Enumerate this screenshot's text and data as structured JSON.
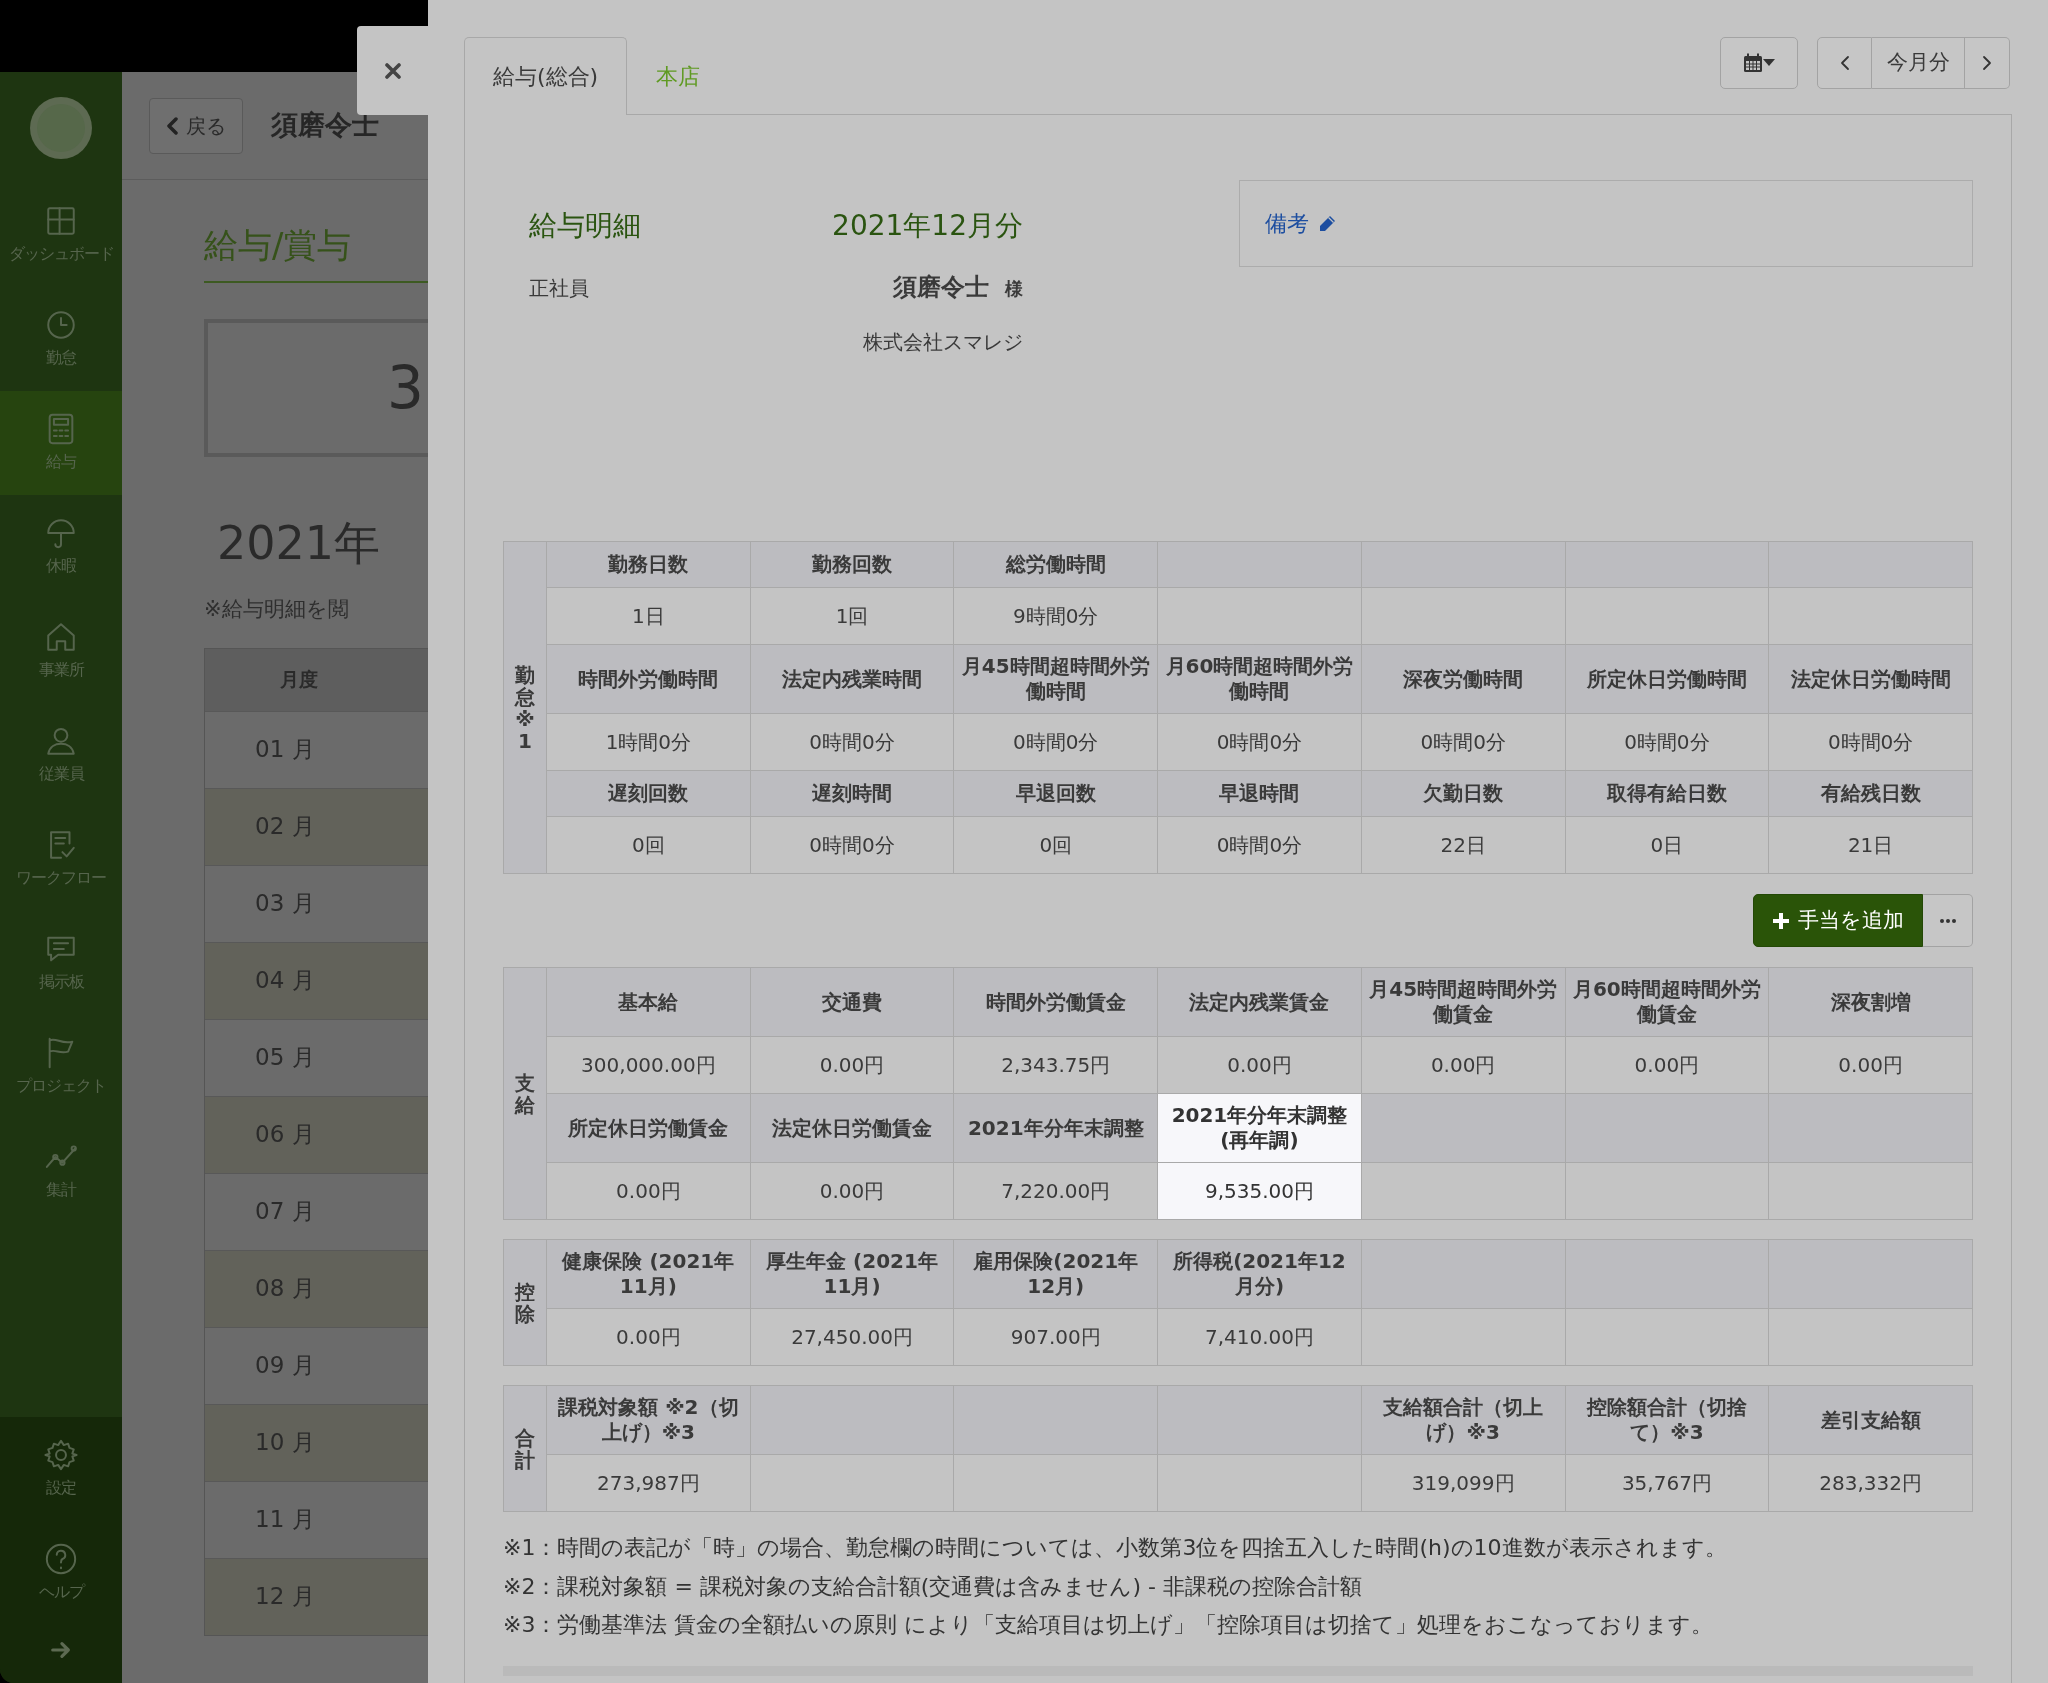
{
  "sidebar": {
    "items": [
      {
        "label": "ダッシュボード",
        "selected": false
      },
      {
        "label": "勤怠",
        "selected": false
      },
      {
        "label": "給与",
        "selected": true
      },
      {
        "label": "休暇",
        "selected": false
      },
      {
        "label": "事業所",
        "selected": false
      },
      {
        "label": "従業員",
        "selected": false
      },
      {
        "label": "ワークフロー",
        "selected": false
      },
      {
        "label": "掲示板",
        "selected": false
      },
      {
        "label": "プロジェクト",
        "selected": false
      },
      {
        "label": "集計",
        "selected": false
      }
    ],
    "footer_items": [
      {
        "label": "設定"
      },
      {
        "label": "ヘルプ"
      }
    ]
  },
  "background_page": {
    "back_button": "戻る",
    "employee_name": "須磨令士",
    "heading": "給与/賞与",
    "summary_value": "3",
    "year": "2021年",
    "note": "※給与明細を閲",
    "month_header": "月度",
    "months": [
      "01 月",
      "02 月",
      "03 月",
      "04 月",
      "05 月",
      "06 月",
      "07 月",
      "08 月",
      "09 月",
      "10 月",
      "11 月",
      "12 月"
    ]
  },
  "modal": {
    "tabs": [
      {
        "label": "給与(総合)",
        "selected": true
      },
      {
        "label": "本店",
        "selected": false
      }
    ],
    "period_button": "今月分",
    "payslip": {
      "title": "給与明細",
      "period": "2021年12月分",
      "employment_type": "正社員",
      "employee_name": "須磨令士",
      "honorific": "様",
      "company": "株式会社スマレジ",
      "remarks_label": "備考"
    },
    "add_button": "手当を追加",
    "sections": [
      {
        "label": "勤怠※1",
        "groups": [
          {
            "cells": [
              {
                "header": "勤務日数",
                "value": "1日",
                "highlighted": false
              },
              {
                "header": "勤務回数",
                "value": "1回",
                "highlighted": false
              },
              {
                "header": "総労働時間",
                "value": "9時間0分",
                "highlighted": false
              },
              {
                "highlighted": false
              },
              {
                "highlighted": false
              },
              {
                "highlighted": false
              },
              {
                "highlighted": false
              }
            ]
          },
          {
            "cells": [
              {
                "header": "時間外労働時間",
                "value": "1時間0分",
                "highlighted": false
              },
              {
                "header": "法定内残業時間",
                "value": "0時間0分",
                "highlighted": false
              },
              {
                "header": "月45時間超時間外労働時間",
                "value": "0時間0分",
                "highlighted": false
              },
              {
                "header": "月60時間超時間外労働時間",
                "value": "0時間0分",
                "highlighted": false
              },
              {
                "header": "深夜労働時間",
                "value": "0時間0分",
                "highlighted": false
              },
              {
                "header": "所定休日労働時間",
                "value": "0時間0分",
                "highlighted": false
              },
              {
                "header": "法定休日労働時間",
                "value": "0時間0分",
                "highlighted": false
              }
            ]
          },
          {
            "cells": [
              {
                "header": "遅刻回数",
                "value": "0回",
                "highlighted": false
              },
              {
                "header": "遅刻時間",
                "value": "0時間0分",
                "highlighted": false
              },
              {
                "header": "早退回数",
                "value": "0回",
                "highlighted": false
              },
              {
                "header": "早退時間",
                "value": "0時間0分",
                "highlighted": false
              },
              {
                "header": "欠勤日数",
                "value": "22日",
                "highlighted": false
              },
              {
                "header": "取得有給日数",
                "value": "0日",
                "highlighted": false
              },
              {
                "header": "有給残日数",
                "value": "21日",
                "highlighted": false
              }
            ]
          }
        ]
      },
      {
        "label": "支給",
        "groups": [
          {
            "cells": [
              {
                "header": "基本給",
                "value": "300,000.00円",
                "highlighted": false
              },
              {
                "header": "交通費",
                "value": "0.00円",
                "highlighted": false
              },
              {
                "header": "時間外労働賃金",
                "value": "2,343.75円",
                "highlighted": false
              },
              {
                "header": "法定内残業賃金",
                "value": "0.00円",
                "highlighted": false
              },
              {
                "header": "月45時間超時間外労働賃金",
                "value": "0.00円",
                "highlighted": false
              },
              {
                "header": "月60時間超時間外労働賃金",
                "value": "0.00円",
                "highlighted": false
              },
              {
                "header": "深夜割増",
                "value": "0.00円",
                "highlighted": false
              }
            ]
          },
          {
            "cells": [
              {
                "header": "所定休日労働賃金",
                "value": "0.00円",
                "highlighted": false
              },
              {
                "header": "法定休日労働賃金",
                "value": "0.00円",
                "highlighted": false
              },
              {
                "header": "2021年分年末調整",
                "value": "7,220.00円",
                "highlighted": false
              },
              {
                "header": "2021年分年末調整(再年調)",
                "value": "9,535.00円",
                "highlighted": true
              },
              {
                "highlighted": false
              },
              {
                "highlighted": false
              },
              {
                "highlighted": false
              }
            ]
          }
        ]
      },
      {
        "label": "控除",
        "groups": [
          {
            "cells": [
              {
                "header": "健康保険 (2021年11月)",
                "value": "0.00円",
                "highlighted": false
              },
              {
                "header": "厚生年金 (2021年11月)",
                "value": "27,450.00円",
                "highlighted": false
              },
              {
                "header": "雇用保険(2021年12月)",
                "value": "907.00円",
                "highlighted": false
              },
              {
                "header": "所得税(2021年12月分)",
                "value": "7,410.00円",
                "highlighted": false
              },
              {
                "highlighted": false
              },
              {
                "highlighted": false
              },
              {
                "highlighted": false
              }
            ]
          }
        ]
      },
      {
        "label": "合計",
        "groups": [
          {
            "cells": [
              {
                "header": "課税対象額 ※2（切上げ）※3",
                "value": "273,987円",
                "highlighted": false
              },
              {
                "highlighted": false
              },
              {
                "highlighted": false
              },
              {
                "highlighted": false
              },
              {
                "header": "支給額合計（切上げ）※3",
                "value": "319,099円",
                "highlighted": false
              },
              {
                "header": "控除額合計（切捨て）※3",
                "value": "35,767円",
                "highlighted": false
              },
              {
                "header": "差引支給額",
                "value": "283,332円",
                "highlighted": false
              }
            ]
          }
        ]
      }
    ],
    "footnotes": [
      "※1：時間の表記が「時」の場合、勤怠欄の時間については、小数第3位を四捨五入した時間(h)の10進数が表示されます。",
      "※2：課税対象額 = 課税対象の支給合計額(交通費は含みません) - 非課税の控除合計額",
      "※3：労働基準法 賃金の全額払いの原則 により「支給項目は切上げ」「控除項目は切捨て」処理をおこなっております。"
    ]
  }
}
